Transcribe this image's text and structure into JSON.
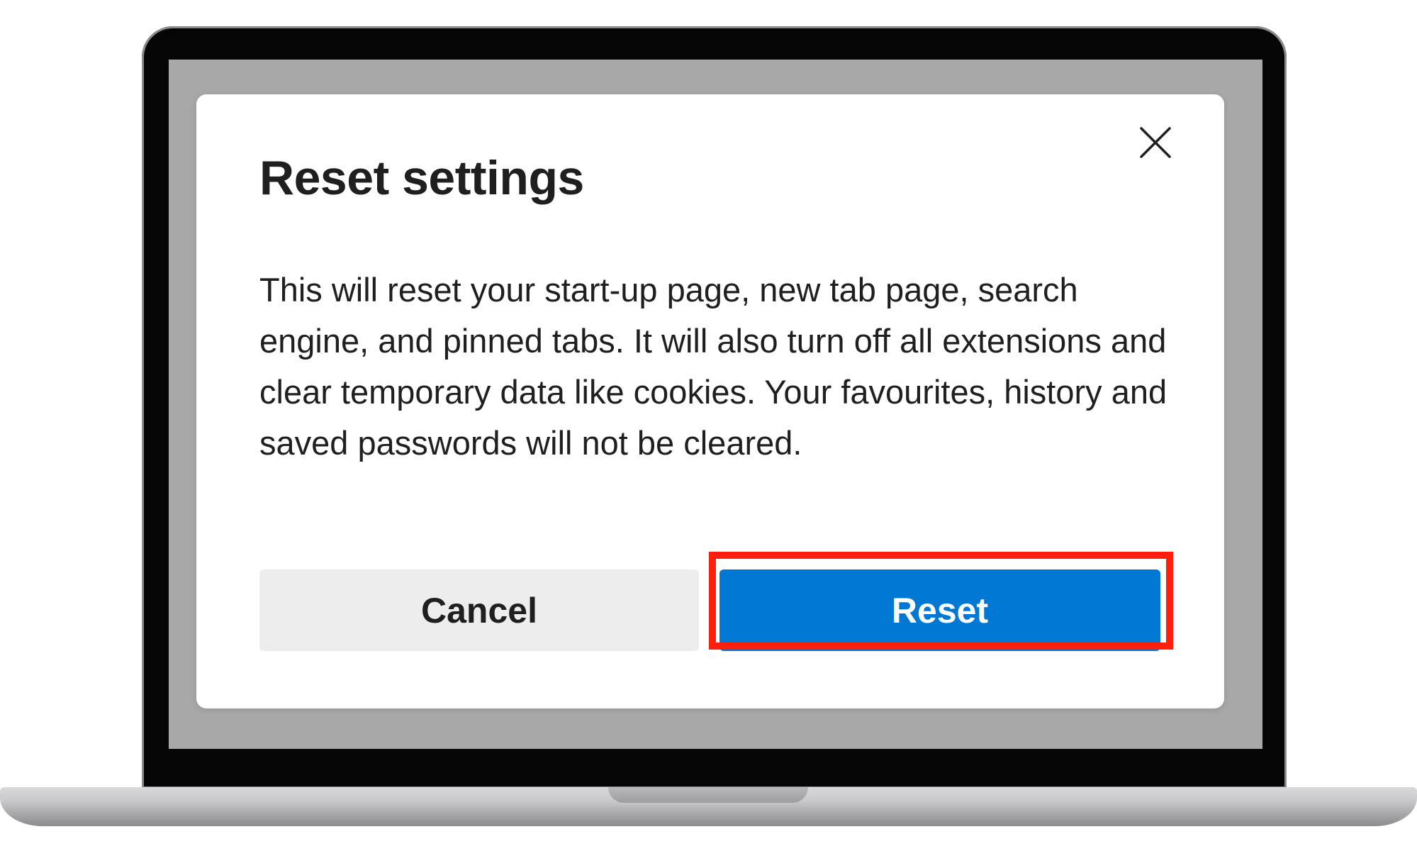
{
  "dialog": {
    "title": "Reset settings",
    "body": "This will reset your start-up page, new tab page, search engine, and pinned tabs. It will also turn off all extensions and clear temporary data like cookies. Your favourites, history and saved passwords will not be cleared.",
    "close_icon": "close-icon",
    "cancel_label": "Cancel",
    "reset_label": "Reset"
  },
  "colors": {
    "primary_button": "#0078d4",
    "secondary_button": "#ededed",
    "highlight": "#ff1f0f",
    "backdrop": "#a8a8a8"
  }
}
